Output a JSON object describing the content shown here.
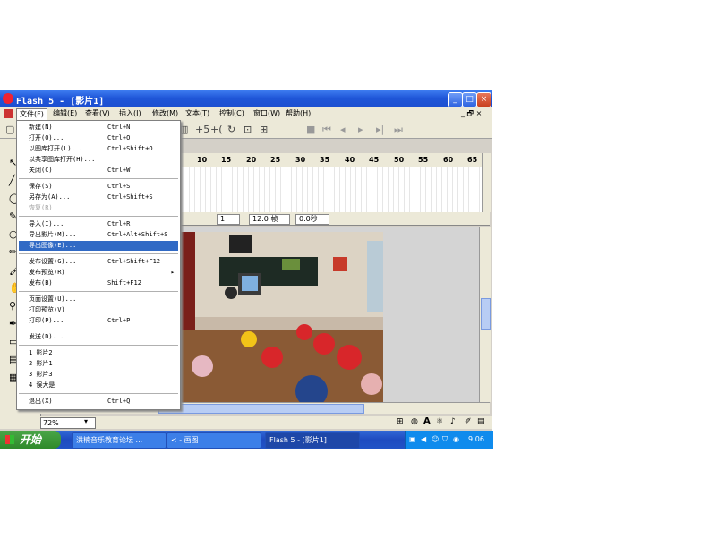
{
  "window": {
    "title": "Flash 5 - [影片1]",
    "controls": {
      "minimize": "_",
      "maximize": "□",
      "close": "×"
    }
  },
  "menubar": {
    "items": [
      "文件(F)",
      "编辑(E)",
      "查看(V)",
      "插入(I)",
      "修改(M)",
      "文本(T)",
      "控制(C)",
      "窗口(W)",
      "帮助(H)"
    ],
    "right": "_ 🗗 ×"
  },
  "file_menu": {
    "groups": [
      [
        {
          "label": "新建(N)",
          "shortcut": "Ctrl+N"
        },
        {
          "label": "打开(O)...",
          "shortcut": "Ctrl+O"
        },
        {
          "label": "以图库打开(L)...",
          "shortcut": "Ctrl+Shift+O"
        },
        {
          "label": "以共享图库打开(H)...",
          "shortcut": ""
        },
        {
          "label": "关闭(C)",
          "shortcut": "Ctrl+W"
        }
      ],
      [
        {
          "label": "保存(S)",
          "shortcut": "Ctrl+S"
        },
        {
          "label": "另存为(A)...",
          "shortcut": "Ctrl+Shift+S"
        },
        {
          "label": "恢复(R)",
          "shortcut": ""
        }
      ],
      [
        {
          "label": "导入(I)...",
          "shortcut": "Ctrl+R"
        },
        {
          "label": "导出影片(M)...",
          "shortcut": "Ctrl+Alt+Shift+S"
        },
        {
          "label": "导出图像(E)...",
          "shortcut": ""
        }
      ],
      [
        {
          "label": "发布设置(G)...",
          "shortcut": "Ctrl+Shift+F12"
        },
        {
          "label": "发布预览(R)",
          "shortcut": ""
        },
        {
          "label": "发布(B)",
          "shortcut": "Shift+F12"
        }
      ],
      [
        {
          "label": "页面设置(U)...",
          "shortcut": ""
        },
        {
          "label": "打印预览(V)",
          "shortcut": ""
        },
        {
          "label": "打印(P)...",
          "shortcut": "Ctrl+P"
        }
      ],
      [
        {
          "label": "发送(D)...",
          "shortcut": ""
        }
      ],
      [
        {
          "label": "1 影片2",
          "shortcut": ""
        },
        {
          "label": "2 影片1",
          "shortcut": ""
        },
        {
          "label": "3 影片3",
          "shortcut": ""
        },
        {
          "label": "4 误大是",
          "shortcut": ""
        }
      ],
      [
        {
          "label": "退出(X)",
          "shortcut": "Ctrl+Q"
        }
      ]
    ]
  },
  "timeline": {
    "ticks": [
      "10",
      "15",
      "20",
      "25",
      "30",
      "35",
      "40",
      "45",
      "50",
      "55",
      "60",
      "65"
    ],
    "frame": "1",
    "fps": "12.0 帧",
    "time": "0.0秒"
  },
  "zoom": "72%",
  "taskbar": {
    "start": "开始",
    "tasks": [
      "洪楠音乐教育论坛 ...",
      "< - 画图",
      "Flash 5 - [影片1]"
    ],
    "clock": "9:06"
  },
  "colors": {
    "title_blue": "#1f56d8",
    "menu_highlight": "#316ac5",
    "taskbar_blue": "#245edb",
    "start_green": "#3c9a38"
  }
}
